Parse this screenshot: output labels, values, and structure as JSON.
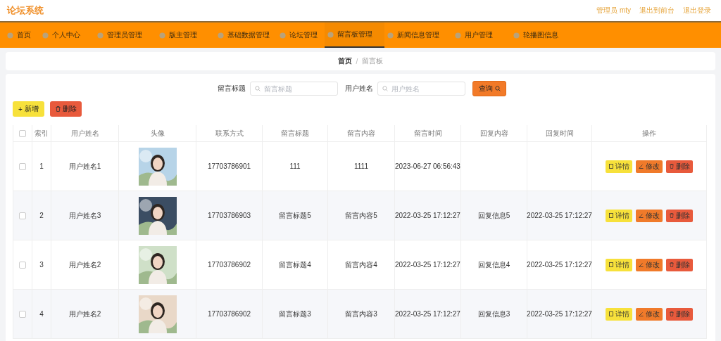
{
  "header": {
    "title": "论坛系统",
    "user": "管理员 mty",
    "links": [
      "退出到前台",
      "退出登录"
    ]
  },
  "nav": [
    {
      "label": "首页",
      "selected": false
    },
    {
      "label": "个人中心",
      "selected": false
    },
    {
      "label": "管理员管理",
      "selected": false
    },
    {
      "label": "版主管理",
      "selected": false
    },
    {
      "label": "基础数据管理",
      "selected": false
    },
    {
      "label": "论坛管理",
      "selected": false
    },
    {
      "label": "留言板管理",
      "selected": true
    },
    {
      "label": "新闻信息管理",
      "selected": false
    },
    {
      "label": "用户管理",
      "selected": false
    },
    {
      "label": "轮播图信息",
      "selected": false
    }
  ],
  "breadcrumb": {
    "items": [
      "首页",
      "留言板"
    ],
    "separator": "/"
  },
  "search": {
    "fields": [
      {
        "label": "留言标题",
        "placeholder": "留言标题"
      },
      {
        "label": "用户姓名",
        "placeholder": "用户姓名"
      }
    ],
    "button": "查询"
  },
  "actions": {
    "add_icon": "+",
    "add": "新增",
    "delete": "删除"
  },
  "table": {
    "header_checked": false,
    "columns": [
      "索引",
      "用户姓名",
      "头像",
      "联系方式",
      "留言标题",
      "留言内容",
      "留言时间",
      "回复内容",
      "回复时间",
      "操作"
    ],
    "rows": [
      {
        "checked": false,
        "index": "1",
        "name": "用户姓名1",
        "avatar": {
          "kind": "picture"
        },
        "phone": "17703786901",
        "title": "111",
        "content": "1111",
        "time": "2023-06-27 06:56:43",
        "reply": "",
        "reply_time": "",
        "actions": [
          "详情",
          "修改",
          "删除"
        ]
      },
      {
        "checked": false,
        "index": "2",
        "name": "用户姓名3",
        "avatar": {
          "kind": "picture"
        },
        "phone": "17703786903",
        "title": "留言标题5",
        "content": "留言内容5",
        "time": "2022-03-25 17:12:27",
        "reply": "回复信息5",
        "reply_time": "2022-03-25 17:12:27",
        "actions": [
          "详情",
          "修改",
          "删除"
        ]
      },
      {
        "checked": false,
        "index": "3",
        "name": "用户姓名2",
        "avatar": {
          "kind": "picture"
        },
        "phone": "17703786902",
        "title": "留言标题4",
        "content": "留言内容4",
        "time": "2022-03-25 17:12:27",
        "reply": "回复信息4",
        "reply_time": "2022-03-25 17:12:27",
        "actions": [
          "详情",
          "修改",
          "删除"
        ]
      },
      {
        "checked": false,
        "index": "4",
        "name": "用户姓名2",
        "avatar": {
          "kind": "picture"
        },
        "phone": "17703786902",
        "title": "留言标题3",
        "content": "留言内容3",
        "time": "2022-03-25 17:12:27",
        "reply": "回复信息3",
        "reply_time": "2022-03-25 17:12:27",
        "actions": [
          "详情",
          "修改",
          "删除"
        ]
      }
    ]
  }
}
